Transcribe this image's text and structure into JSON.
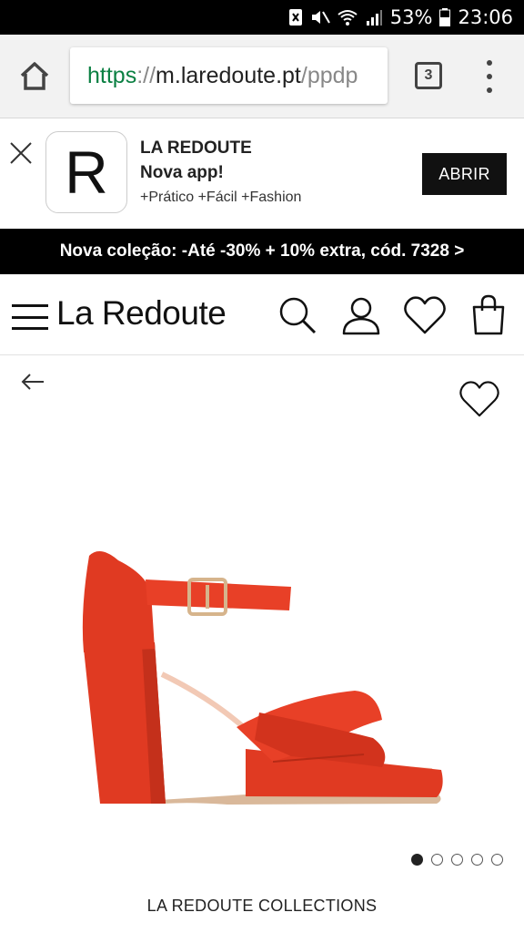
{
  "status_bar": {
    "battery": "53%",
    "time": "23:06",
    "icons": [
      "nfc-icon",
      "mute-icon",
      "wifi-icon",
      "signal-icon",
      "battery-icon"
    ]
  },
  "browser": {
    "url_scheme": "https",
    "url_sep": "://",
    "url_host": "m.laredoute.pt",
    "url_path": "/ppdp",
    "tab_count": "3"
  },
  "app_banner": {
    "logo_letter": "R",
    "name": "LA REDOUTE",
    "subtitle": "Nova app!",
    "description": "+Prático +Fácil +Fashion",
    "open_label": "ABRIR"
  },
  "promo": {
    "text": "Nova coleção: -Até -30% + 10% extra, cód. 7328 >"
  },
  "header": {
    "brand": "La Redoute",
    "icons": [
      "menu-icon",
      "search-icon",
      "account-icon",
      "wishlist-icon",
      "bag-icon"
    ]
  },
  "product": {
    "image_icon": "red-sandal-image",
    "carousel_count": 5,
    "carousel_active": 1,
    "brand_label": "LA REDOUTE COLLECTIONS"
  },
  "colors": {
    "product_red": "#e03a22",
    "url_green": "#0b8043",
    "black": "#000000"
  }
}
